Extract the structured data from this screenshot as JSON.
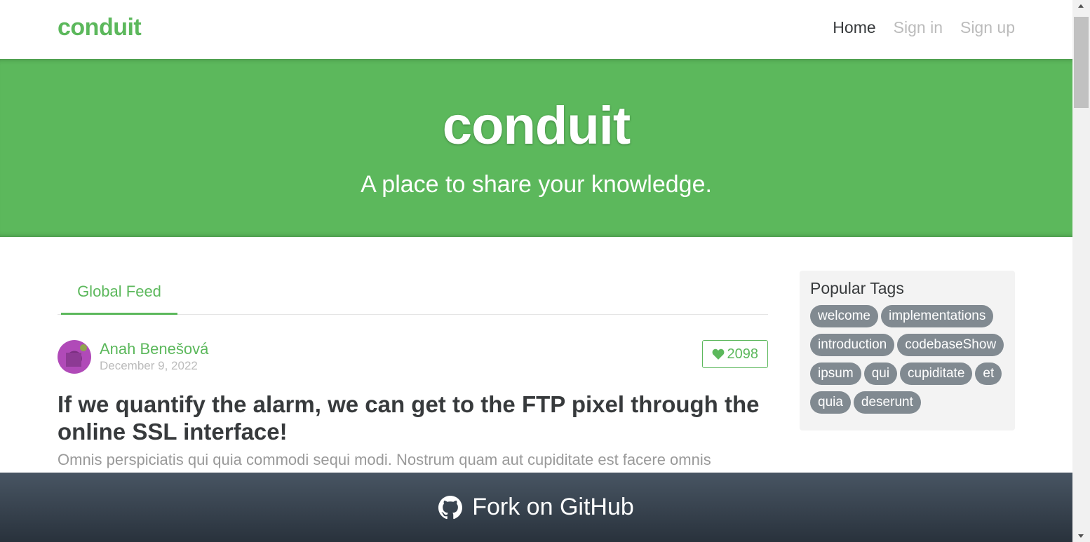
{
  "navbar": {
    "brand": "conduit",
    "links": [
      {
        "label": "Home",
        "active": true
      },
      {
        "label": "Sign in",
        "active": false
      },
      {
        "label": "Sign up",
        "active": false
      }
    ]
  },
  "banner": {
    "title": "conduit",
    "subtitle": "A place to share your knowledge."
  },
  "feed": {
    "tabs": [
      {
        "label": "Global Feed",
        "active": true
      }
    ]
  },
  "article": {
    "author": "Anah Benešová",
    "date": "December 9, 2022",
    "likes": "2098",
    "title": "If we quantify the alarm, we can get to the FTP pixel through the online SSL interface!",
    "description": "Omnis perspiciatis qui quia commodi sequi modi. Nostrum quam aut cupiditate est facere omnis"
  },
  "sidebar": {
    "title": "Popular Tags",
    "tags": [
      "welcome",
      "implementations",
      "introduction",
      "codebaseShow",
      "ipsum",
      "qui",
      "cupiditate",
      "et",
      "quia",
      "deserunt"
    ]
  },
  "footer": {
    "label": "Fork on GitHub",
    "icon": "github-icon"
  },
  "colors": {
    "brand": "#5cb85c",
    "tag": "#818a91",
    "footer_top": "#485563",
    "footer_bottom": "#29323c"
  }
}
